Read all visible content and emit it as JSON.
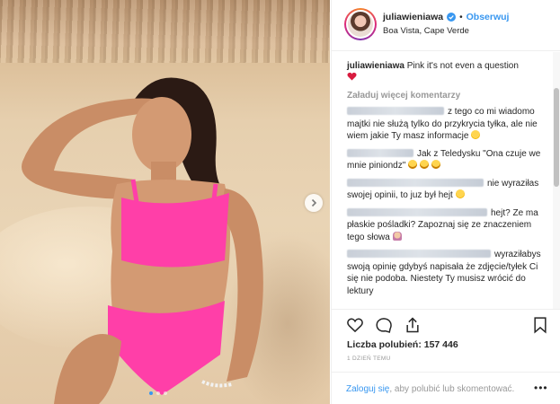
{
  "post": {
    "photo_alt": "Pink it's not even a question",
    "carousel": {
      "slide_count": 3,
      "active_index": 0
    }
  },
  "header": {
    "username": "juliawieniawa",
    "separator": "•",
    "follow_label": "Obserwuj",
    "location": "Boa Vista, Cape Verde"
  },
  "caption": {
    "username": "juliawieniawa",
    "text": "Pink it's not even a question"
  },
  "load_more_label": "Załaduj więcej komentarzy",
  "comments": [
    {
      "text": "z tego co mi wiadomo majtki nie służą tylko do przykrycia tyłka, ale nie wiem jakie Ty masz informacje",
      "emoji": "smile-emoji"
    },
    {
      "text": "Jak z Teledysku \"Ona czuje we mnie piniondz\"",
      "emoji": "laugh-emoji-x3"
    },
    {
      "text": "nie wyraziłas swojej opinii, to juz był hejt",
      "emoji": "smile-emoji"
    },
    {
      "text": "hejt? Ze ma płaskie pośladki? Zapoznaj się ze znaczeniem tego słowa",
      "emoji": "shrug-emoji"
    },
    {
      "text": "wyraziłabys swoją opinię gdybyś napisała że zdjęcie/tyłek Ci się nie podoba. Niestety Ty musisz wrócić do lektury",
      "emoji": ""
    }
  ],
  "actions": {
    "likes_label": "Liczba polubień: 157 446",
    "date_label": "1 DZIEŃ TEMU"
  },
  "footer": {
    "login_link": "Zaloguj się",
    "login_rest": ", aby polubić lub skomentować.",
    "more_label": "•••"
  },
  "colors": {
    "accent": "#3897f0",
    "text": "#262626",
    "muted": "#999999",
    "bikini_pink": "#ff3fa8",
    "border": "#efefef"
  }
}
